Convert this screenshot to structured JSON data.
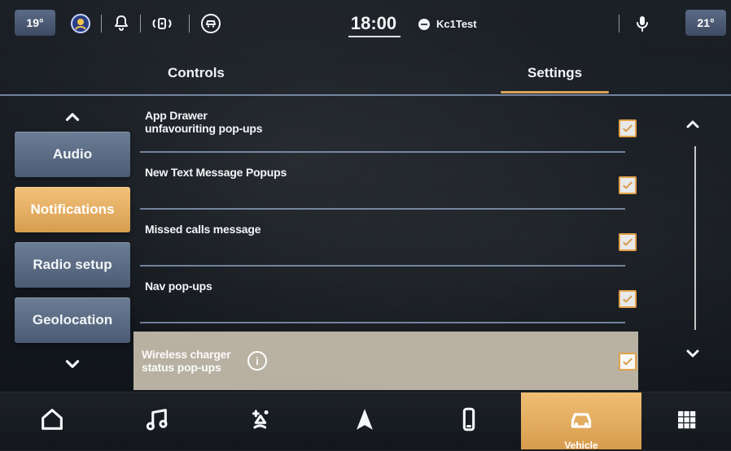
{
  "status_bar": {
    "temp_left": "19°",
    "temp_right": "21°",
    "time": "18:00",
    "profile_name": "Kc1Test"
  },
  "tabs": {
    "controls": "Controls",
    "settings": "Settings"
  },
  "left_nav": {
    "items": [
      {
        "label": "Audio"
      },
      {
        "label": "Notifications"
      },
      {
        "label": "Radio setup"
      },
      {
        "label": "Geolocation"
      }
    ],
    "selected": "Notifications"
  },
  "settings_list": {
    "rows": [
      {
        "label_line1": "App Drawer",
        "label_line2": "unfavouriting pop-ups",
        "checked": true
      },
      {
        "label_line1": "New Text Message Popups",
        "label_line2": "",
        "checked": true
      },
      {
        "label_line1": "Missed calls message",
        "label_line2": "",
        "checked": true
      },
      {
        "label_line1": "Nav pop-ups",
        "label_line2": "",
        "checked": true
      },
      {
        "label_line1": "Wireless charger",
        "label_line2": "status pop-ups",
        "checked": true,
        "info": "i"
      }
    ]
  },
  "bottom_nav": {
    "items": [
      {
        "icon": "home-icon"
      },
      {
        "icon": "music-icon"
      },
      {
        "icon": "climate-icon"
      },
      {
        "icon": "navigation-icon"
      },
      {
        "icon": "phone-icon"
      },
      {
        "icon": "vehicle-icon",
        "label": "Vehicle",
        "active": true
      },
      {
        "icon": "apps-grid-icon"
      }
    ]
  },
  "colors": {
    "accent": "#d79b4c",
    "divider": "#a2b8dc",
    "nav_item": "#5f7290"
  }
}
